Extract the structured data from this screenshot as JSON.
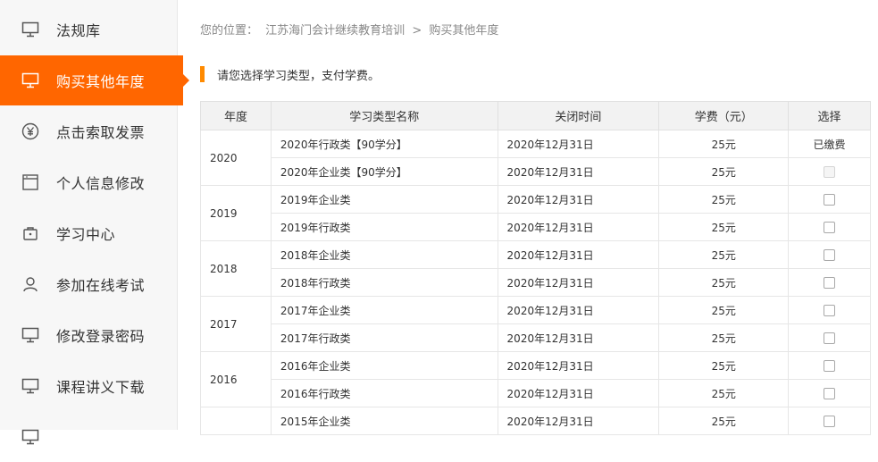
{
  "sidebar": {
    "items": [
      {
        "label": "法规库",
        "icon": "monitor-icon",
        "active": false
      },
      {
        "label": "购买其他年度",
        "icon": "monitor-icon",
        "active": true
      },
      {
        "label": "点击索取发票",
        "icon": "yen-icon",
        "active": false
      },
      {
        "label": "个人信息修改",
        "icon": "window-icon",
        "active": false
      },
      {
        "label": "学习中心",
        "icon": "briefcase-icon",
        "active": false
      },
      {
        "label": "参加在线考试",
        "icon": "user-icon",
        "active": false
      },
      {
        "label": "修改登录密码",
        "icon": "monitor-icon",
        "active": false
      },
      {
        "label": "课程讲义下载",
        "icon": "monitor-icon",
        "active": false
      }
    ]
  },
  "breadcrumb": {
    "prefix": "您的位置：",
    "site": "江苏海门会计继续教育培训",
    "separator": ">",
    "current": "购买其他年度"
  },
  "notice": "请您选择学习类型，支付学费。",
  "table": {
    "headers": [
      "年度",
      "学习类型名称",
      "关闭时间",
      "学费（元）",
      "选择"
    ],
    "groups": [
      {
        "year": "2020",
        "rows": [
          {
            "name": "2020年行政类【90学分】",
            "close": "2020年12月31日",
            "fee": "25元",
            "select": "已缴费"
          },
          {
            "name": "2020年企业类【90学分】",
            "close": "2020年12月31日",
            "fee": "25元",
            "select": "disabled"
          }
        ]
      },
      {
        "year": "2019",
        "rows": [
          {
            "name": "2019年企业类",
            "close": "2020年12月31日",
            "fee": "25元",
            "select": "checkbox"
          },
          {
            "name": "2019年行政类",
            "close": "2020年12月31日",
            "fee": "25元",
            "select": "checkbox"
          }
        ]
      },
      {
        "year": "2018",
        "rows": [
          {
            "name": "2018年企业类",
            "close": "2020年12月31日",
            "fee": "25元",
            "select": "checkbox"
          },
          {
            "name": "2018年行政类",
            "close": "2020年12月31日",
            "fee": "25元",
            "select": "checkbox"
          }
        ]
      },
      {
        "year": "2017",
        "rows": [
          {
            "name": "2017年企业类",
            "close": "2020年12月31日",
            "fee": "25元",
            "select": "checkbox"
          },
          {
            "name": "2017年行政类",
            "close": "2020年12月31日",
            "fee": "25元",
            "select": "checkbox"
          }
        ]
      },
      {
        "year": "2016",
        "rows": [
          {
            "name": "2016年企业类",
            "close": "2020年12月31日",
            "fee": "25元",
            "select": "checkbox"
          },
          {
            "name": "2016年行政类",
            "close": "2020年12月31日",
            "fee": "25元",
            "select": "checkbox"
          }
        ]
      },
      {
        "year": "",
        "rows": [
          {
            "name": "2015年企业类",
            "close": "2020年12月31日",
            "fee": "25元",
            "select": "checkbox"
          }
        ]
      }
    ]
  },
  "colors": {
    "accent": "#ff6600",
    "notice_bar": "#ff8a00",
    "sidebar_bg": "#f7f7f7"
  }
}
